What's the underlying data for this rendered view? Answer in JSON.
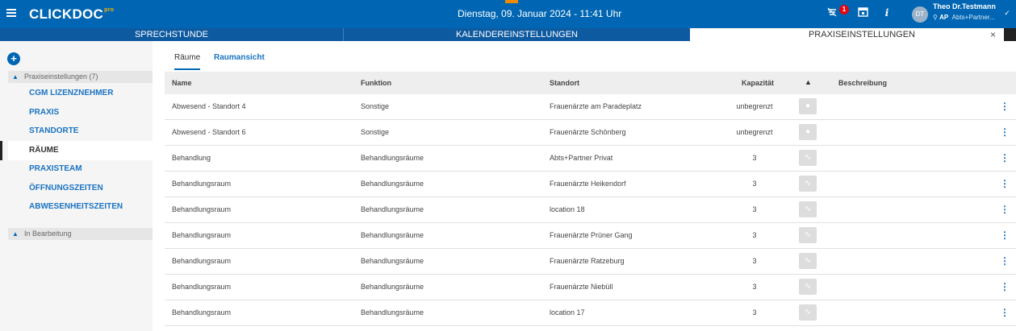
{
  "header": {
    "logo": "CLICKDOC",
    "logo_suffix": "pro",
    "datetime": "Dienstag, 09. Januar 2024 - 11:41 Uhr",
    "badge_count": "1",
    "avatar_initials": "DT",
    "user_name": "Theo Dr.Testmann",
    "user_role": "AP",
    "user_practice": "Abts+Partner..."
  },
  "nav": {
    "tabs": [
      "SPRECHSTUNDE",
      "KALENDEREINSTELLUNGEN",
      "PRAXISEINSTELLUNGEN"
    ],
    "close": "×"
  },
  "sidebar": {
    "add": "+",
    "group1": "Praxiseinstellungen (7)",
    "items": [
      "CGM LIZENZNEHMER",
      "PRAXIS",
      "STANDORTE",
      "RÄUME",
      "PRAXISTEAM",
      "ÖFFNUNGSZEITEN",
      "ABWESENHEITSZEITEN"
    ],
    "active_index": 3,
    "group2": "In Bearbeitung"
  },
  "main": {
    "subtabs": [
      "Räume",
      "Raumansicht"
    ],
    "columns": [
      "Name",
      "Funktion",
      "Standort",
      "Kapazität",
      "",
      "Beschreibung"
    ],
    "rows": [
      [
        "Abwesend - Standort 4",
        "Sonstige",
        "Frauenärzte am Paradeplatz",
        "unbegrenzt"
      ],
      [
        "Abwesend - Standort 6",
        "Sonstige",
        "Frauenärzte Schönberg",
        "unbegrenzt"
      ],
      [
        "Behandlung",
        "Behandlungsräume",
        "Abts+Partner Privat",
        "3"
      ],
      [
        "Behandlungsraum",
        "Behandlungsräume",
        "Frauenärzte Heikendorf",
        "3"
      ],
      [
        "Behandlungsraum",
        "Behandlungsräume",
        "location 18",
        "3"
      ],
      [
        "Behandlungsraum",
        "Behandlungsräume",
        "Frauenärzte Prüner Gang",
        "3"
      ],
      [
        "Behandlungsraum",
        "Behandlungsräume",
        "Frauenärzte Ratzeburg",
        "3"
      ],
      [
        "Behandlungsraum",
        "Behandlungsräume",
        "Frauenärzte Niebüll",
        "3"
      ],
      [
        "Behandlungsraum",
        "Behandlungsräume",
        "location 17",
        "3"
      ]
    ]
  },
  "colors": {
    "brand": "#0066b3",
    "nav": "#0e5aa0",
    "accent": "#f28b00",
    "badge": "#e30613"
  }
}
